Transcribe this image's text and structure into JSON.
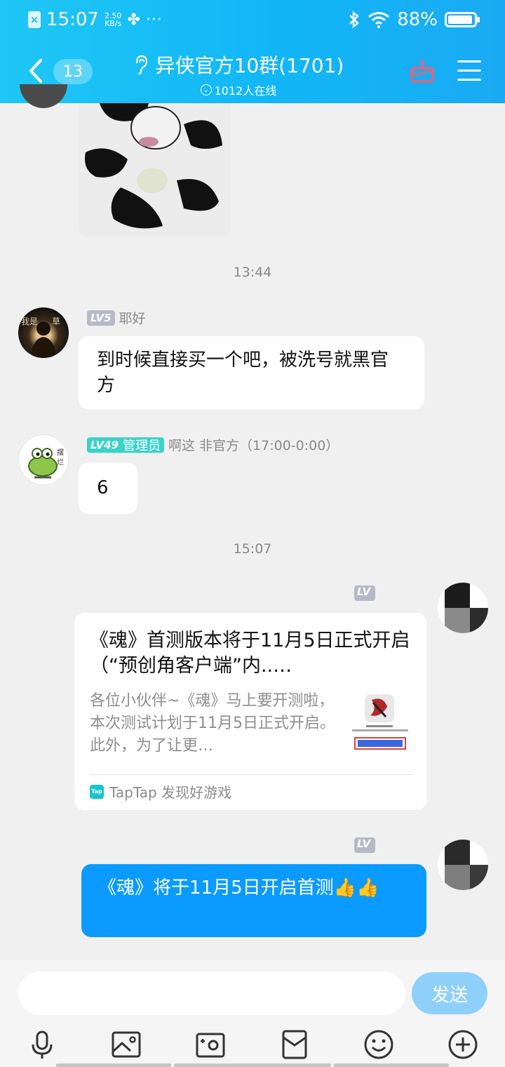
{
  "status_bar": {
    "time": "15:07",
    "net_speed_value": "2.50",
    "net_speed_unit": "KB/s",
    "battery": "88%"
  },
  "header": {
    "unread_count": "13",
    "group_name": "异侠官方10群(1701)",
    "online_count": "1012人在线"
  },
  "chat": {
    "timestamps": [
      "13:44",
      "15:07"
    ],
    "messages": [
      {
        "level": "LV5",
        "sender": "耶好",
        "text": "到时候直接买一个吧，被洗号就黑官方"
      },
      {
        "level": "LV49",
        "role": "管理员",
        "sender": "啊这 非官方（17:00-0:00）",
        "text": "6"
      }
    ],
    "self_level": "LV",
    "share_card": {
      "title": "《魂》首测版本将于11月5日正式开启（“预创角客户端”内..…",
      "description": "各位小伙伴~《魂》马上要开测啦，本次测试计划于11月5日正式开启。此外，为了让更…",
      "source_logo": "Tap",
      "source": "TapTap 发现好游戏"
    },
    "self_message": "《魂》将于11月5日开启首测👍👍"
  },
  "input": {
    "placeholder": "",
    "send_label": "发送"
  },
  "toolbar": {
    "icons": [
      "microphone-icon",
      "image-icon",
      "video-icon",
      "red-packet-icon",
      "emoji-icon",
      "plus-icon"
    ]
  },
  "colors": {
    "header": "#12b6f7",
    "self_bubble": "#0b9bff",
    "send_button": "#8fd0fb"
  }
}
